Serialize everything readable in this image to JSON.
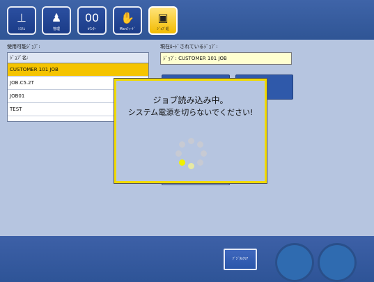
{
  "toolbar": {
    "items": [
      {
        "label": "ｼｽﾃﾑ",
        "icon": "system-icon"
      },
      {
        "label": "管理",
        "icon": "admin-icon"
      },
      {
        "label": "ｶｳﾝﾀｰ",
        "icon": "counter-icon"
      },
      {
        "label": "Manﾌｨｰﾄﾞ",
        "icon": "manual-feed-icon"
      },
      {
        "label": "ｼﾞｮﾌﾞ処",
        "icon": "job-icon",
        "active": true
      }
    ]
  },
  "labels": {
    "available_jobs": "使用可能ｼﾞｮﾌﾞ:",
    "loaded_job": "現在ﾛｰﾄﾞされているｼﾞｮﾌﾞ:"
  },
  "job_list": {
    "header": "ｼﾞｮﾌﾞ名:",
    "rows": [
      "CUSTOMER 101 JOB",
      "JOB.C5.2T",
      "JOB01",
      "TEST"
    ]
  },
  "current_job_value": "ｼﾞｮﾌﾞ: CUSTOMER 101 JOB",
  "modal": {
    "line1": "ジョブ読み込み中。",
    "line2": "システム電源を切らないでください!"
  },
  "bottom": {
    "clear_label": "ﾃﾞｼﾞﾀﾙｸﾘｱ"
  },
  "colors": {
    "accent": "#f5c400",
    "bar_blue": "#2f5595",
    "modal_border": "#f0d900"
  }
}
